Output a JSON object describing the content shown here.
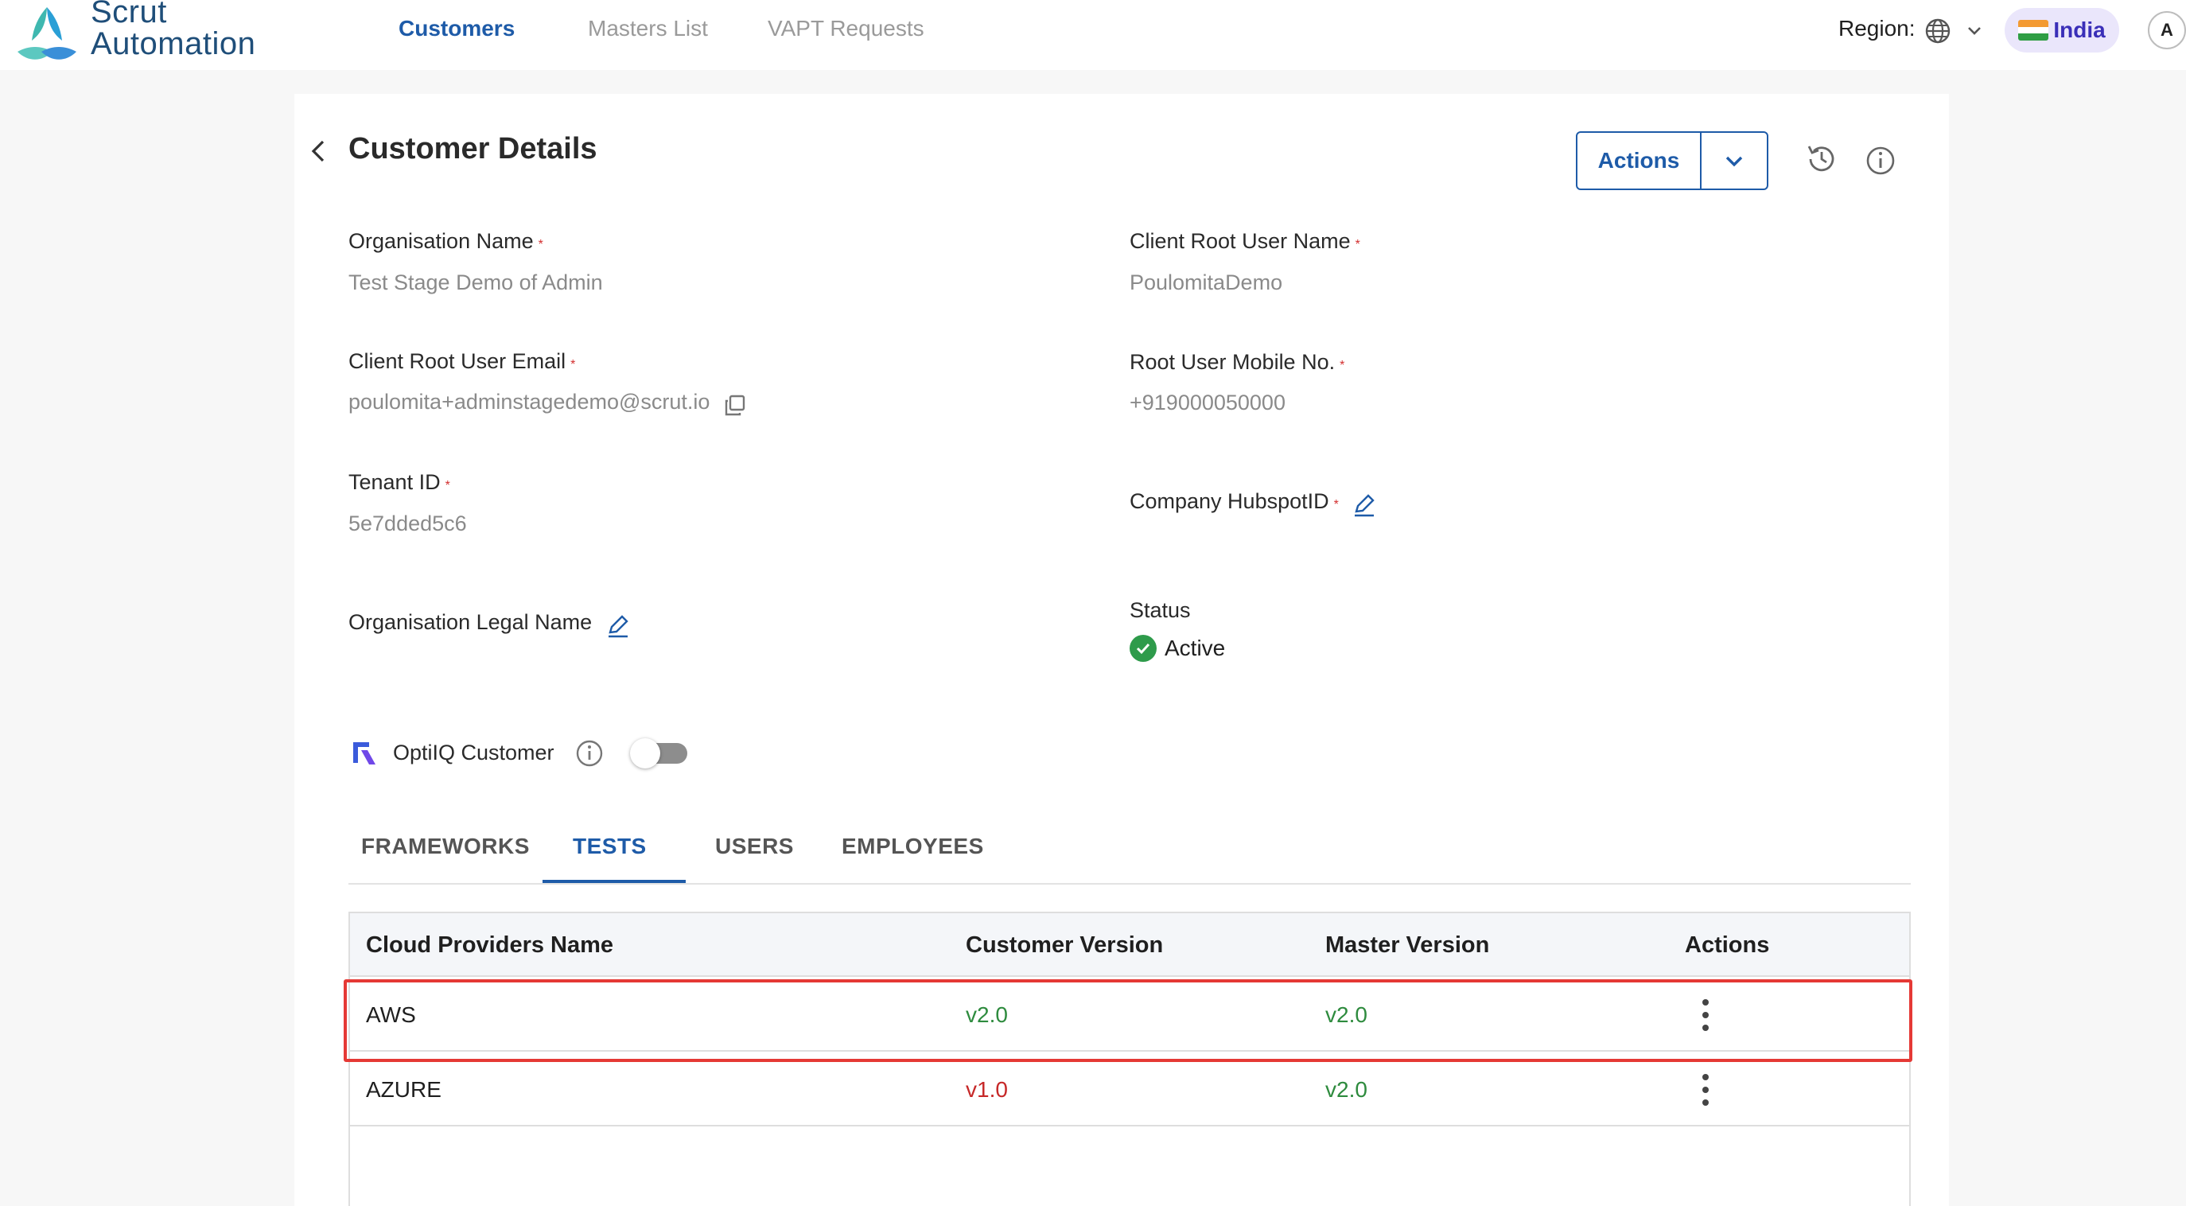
{
  "brand": {
    "line1": "Scrut",
    "line2": "Automation"
  },
  "nav": {
    "items": [
      {
        "label": "Customers",
        "active": true
      },
      {
        "label": "Masters List",
        "active": false
      },
      {
        "label": "VAPT Requests",
        "active": false
      }
    ]
  },
  "region": {
    "label": "Region:",
    "country": "India",
    "avatar_initial": "A"
  },
  "page": {
    "title": "Customer Details",
    "actions_label": "Actions"
  },
  "fields": {
    "org_name": {
      "label": "Organisation Name",
      "value": "Test Stage Demo of Admin"
    },
    "root_user_name": {
      "label": "Client Root User Name",
      "value": "PoulomitaDemo"
    },
    "root_user_email": {
      "label": "Client Root User Email",
      "value": "poulomita+adminstagedemo@scrut.io"
    },
    "root_user_mobile": {
      "label": "Root User Mobile No.",
      "value": "+919000050000"
    },
    "tenant_id": {
      "label": "Tenant ID",
      "value": "5e7dded5c6"
    },
    "hubspot_id": {
      "label": "Company HubspotID"
    },
    "legal_name": {
      "label": "Organisation Legal Name"
    },
    "status": {
      "label": "Status",
      "value": "Active"
    }
  },
  "required_mark": "*",
  "optiq": {
    "label": "OptiIQ Customer",
    "enabled": false
  },
  "tabs": [
    {
      "label": "FRAMEWORKS",
      "active": false
    },
    {
      "label": "TESTS",
      "active": true
    },
    {
      "label": "USERS",
      "active": false
    },
    {
      "label": "EMPLOYEES",
      "active": false
    }
  ],
  "table": {
    "columns": [
      "Cloud Providers Name",
      "Customer Version",
      "Master Version",
      "Actions"
    ],
    "rows": [
      {
        "name": "AWS",
        "customer_version": "v2.0",
        "master_version": "v2.0",
        "highlighted": true
      },
      {
        "name": "AZURE",
        "customer_version": "v1.0",
        "master_version": "v2.0",
        "highlighted": false
      }
    ]
  },
  "colors": {
    "accent": "#1e5ba8",
    "success": "#2e9b4b",
    "danger": "#c62828",
    "highlight": "#e53935"
  }
}
